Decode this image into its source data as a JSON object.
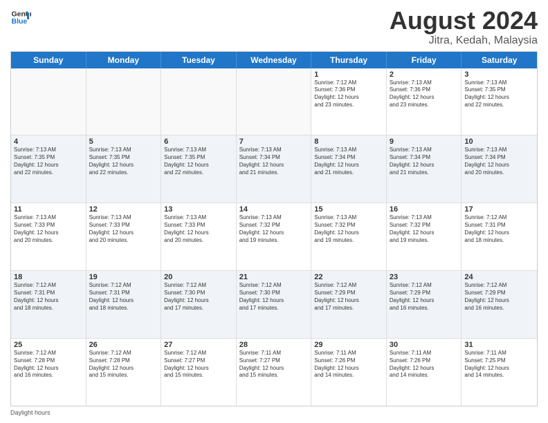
{
  "header": {
    "logo_line1": "General",
    "logo_line2": "Blue",
    "month": "August 2024",
    "location": "Jitra, Kedah, Malaysia"
  },
  "days_of_week": [
    "Sunday",
    "Monday",
    "Tuesday",
    "Wednesday",
    "Thursday",
    "Friday",
    "Saturday"
  ],
  "footer": {
    "daylight_label": "Daylight hours"
  },
  "weeks": [
    [
      {
        "day": "",
        "text": ""
      },
      {
        "day": "",
        "text": ""
      },
      {
        "day": "",
        "text": ""
      },
      {
        "day": "",
        "text": ""
      },
      {
        "day": "1",
        "text": "Sunrise: 7:12 AM\nSunset: 7:36 PM\nDaylight: 12 hours\nand 23 minutes."
      },
      {
        "day": "2",
        "text": "Sunrise: 7:13 AM\nSunset: 7:36 PM\nDaylight: 12 hours\nand 23 minutes."
      },
      {
        "day": "3",
        "text": "Sunrise: 7:13 AM\nSunset: 7:35 PM\nDaylight: 12 hours\nand 22 minutes."
      }
    ],
    [
      {
        "day": "4",
        "text": "Sunrise: 7:13 AM\nSunset: 7:35 PM\nDaylight: 12 hours\nand 22 minutes."
      },
      {
        "day": "5",
        "text": "Sunrise: 7:13 AM\nSunset: 7:35 PM\nDaylight: 12 hours\nand 22 minutes."
      },
      {
        "day": "6",
        "text": "Sunrise: 7:13 AM\nSunset: 7:35 PM\nDaylight: 12 hours\nand 22 minutes."
      },
      {
        "day": "7",
        "text": "Sunrise: 7:13 AM\nSunset: 7:34 PM\nDaylight: 12 hours\nand 21 minutes."
      },
      {
        "day": "8",
        "text": "Sunrise: 7:13 AM\nSunset: 7:34 PM\nDaylight: 12 hours\nand 21 minutes."
      },
      {
        "day": "9",
        "text": "Sunrise: 7:13 AM\nSunset: 7:34 PM\nDaylight: 12 hours\nand 21 minutes."
      },
      {
        "day": "10",
        "text": "Sunrise: 7:13 AM\nSunset: 7:34 PM\nDaylight: 12 hours\nand 20 minutes."
      }
    ],
    [
      {
        "day": "11",
        "text": "Sunrise: 7:13 AM\nSunset: 7:33 PM\nDaylight: 12 hours\nand 20 minutes."
      },
      {
        "day": "12",
        "text": "Sunrise: 7:13 AM\nSunset: 7:33 PM\nDaylight: 12 hours\nand 20 minutes."
      },
      {
        "day": "13",
        "text": "Sunrise: 7:13 AM\nSunset: 7:33 PM\nDaylight: 12 hours\nand 20 minutes."
      },
      {
        "day": "14",
        "text": "Sunrise: 7:13 AM\nSunset: 7:32 PM\nDaylight: 12 hours\nand 19 minutes."
      },
      {
        "day": "15",
        "text": "Sunrise: 7:13 AM\nSunset: 7:32 PM\nDaylight: 12 hours\nand 19 minutes."
      },
      {
        "day": "16",
        "text": "Sunrise: 7:13 AM\nSunset: 7:32 PM\nDaylight: 12 hours\nand 19 minutes."
      },
      {
        "day": "17",
        "text": "Sunrise: 7:12 AM\nSunset: 7:31 PM\nDaylight: 12 hours\nand 18 minutes."
      }
    ],
    [
      {
        "day": "18",
        "text": "Sunrise: 7:12 AM\nSunset: 7:31 PM\nDaylight: 12 hours\nand 18 minutes."
      },
      {
        "day": "19",
        "text": "Sunrise: 7:12 AM\nSunset: 7:31 PM\nDaylight: 12 hours\nand 18 minutes."
      },
      {
        "day": "20",
        "text": "Sunrise: 7:12 AM\nSunset: 7:30 PM\nDaylight: 12 hours\nand 17 minutes."
      },
      {
        "day": "21",
        "text": "Sunrise: 7:12 AM\nSunset: 7:30 PM\nDaylight: 12 hours\nand 17 minutes."
      },
      {
        "day": "22",
        "text": "Sunrise: 7:12 AM\nSunset: 7:29 PM\nDaylight: 12 hours\nand 17 minutes."
      },
      {
        "day": "23",
        "text": "Sunrise: 7:12 AM\nSunset: 7:29 PM\nDaylight: 12 hours\nand 16 minutes."
      },
      {
        "day": "24",
        "text": "Sunrise: 7:12 AM\nSunset: 7:29 PM\nDaylight: 12 hours\nand 16 minutes."
      }
    ],
    [
      {
        "day": "25",
        "text": "Sunrise: 7:12 AM\nSunset: 7:28 PM\nDaylight: 12 hours\nand 16 minutes."
      },
      {
        "day": "26",
        "text": "Sunrise: 7:12 AM\nSunset: 7:28 PM\nDaylight: 12 hours\nand 15 minutes."
      },
      {
        "day": "27",
        "text": "Sunrise: 7:12 AM\nSunset: 7:27 PM\nDaylight: 12 hours\nand 15 minutes."
      },
      {
        "day": "28",
        "text": "Sunrise: 7:11 AM\nSunset: 7:27 PM\nDaylight: 12 hours\nand 15 minutes."
      },
      {
        "day": "29",
        "text": "Sunrise: 7:11 AM\nSunset: 7:26 PM\nDaylight: 12 hours\nand 14 minutes."
      },
      {
        "day": "30",
        "text": "Sunrise: 7:11 AM\nSunset: 7:26 PM\nDaylight: 12 hours\nand 14 minutes."
      },
      {
        "day": "31",
        "text": "Sunrise: 7:11 AM\nSunset: 7:25 PM\nDaylight: 12 hours\nand 14 minutes."
      }
    ]
  ]
}
